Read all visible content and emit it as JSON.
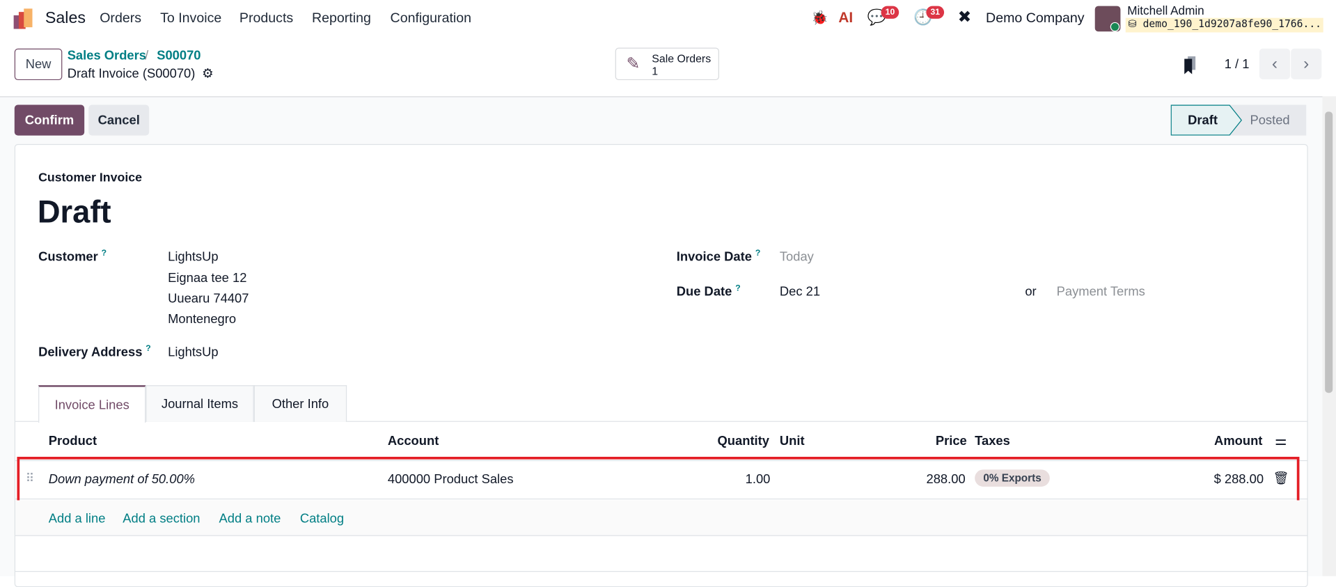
{
  "nav": {
    "app": "Sales",
    "menu": [
      "Orders",
      "To Invoice",
      "Products",
      "Reporting",
      "Configuration"
    ],
    "chat_count": "10",
    "activity_count": "31",
    "company": "Demo Company",
    "user": "Mitchell Admin",
    "database": "demo_190_1d9207a8fe90_1766..."
  },
  "control": {
    "new_label": "New",
    "breadcrumb_parent": "Sales Orders",
    "breadcrumb_sep": "/",
    "breadcrumb_order": "S00070",
    "record_title": "Draft Invoice (S00070)",
    "smart_button_label": "Sale Orders",
    "smart_button_count": "1",
    "pager": "1 / 1"
  },
  "actions": {
    "confirm": "Confirm",
    "cancel": "Cancel"
  },
  "status": {
    "steps": [
      "Draft",
      "Posted"
    ],
    "current": "Draft"
  },
  "form": {
    "type_label": "Customer Invoice",
    "state_title": "Draft",
    "customer_label": "Customer",
    "help": "?",
    "customer_lines": [
      "LightsUp",
      "Eignaa tee 12",
      "Uuearu 74407",
      "Montenegro"
    ],
    "delivery_label": "Delivery Address",
    "delivery_value": "LightsUp",
    "invoice_date_label": "Invoice Date",
    "invoice_date_placeholder": "Today",
    "due_date_label": "Due Date",
    "due_date_value": "Dec 21",
    "or": "or",
    "payment_terms_placeholder": "Payment Terms"
  },
  "tabs": [
    "Invoice Lines",
    "Journal Items",
    "Other Info"
  ],
  "table": {
    "headers": {
      "product": "Product",
      "account": "Account",
      "quantity": "Quantity",
      "unit": "Unit",
      "price": "Price",
      "taxes": "Taxes",
      "amount": "Amount"
    },
    "rows": [
      {
        "product": "Down payment of 50.00%",
        "account": "400000 Product Sales",
        "quantity": "1.00",
        "unit": "",
        "price": "288.00",
        "tax": "0% Exports",
        "amount": "$ 288.00"
      }
    ],
    "add_links": [
      "Add a line",
      "Add a section",
      "Add a note",
      "Catalog"
    ]
  },
  "colors": {
    "primary": "#714b67",
    "teal": "#017e84",
    "highlight": "#e41e26"
  }
}
